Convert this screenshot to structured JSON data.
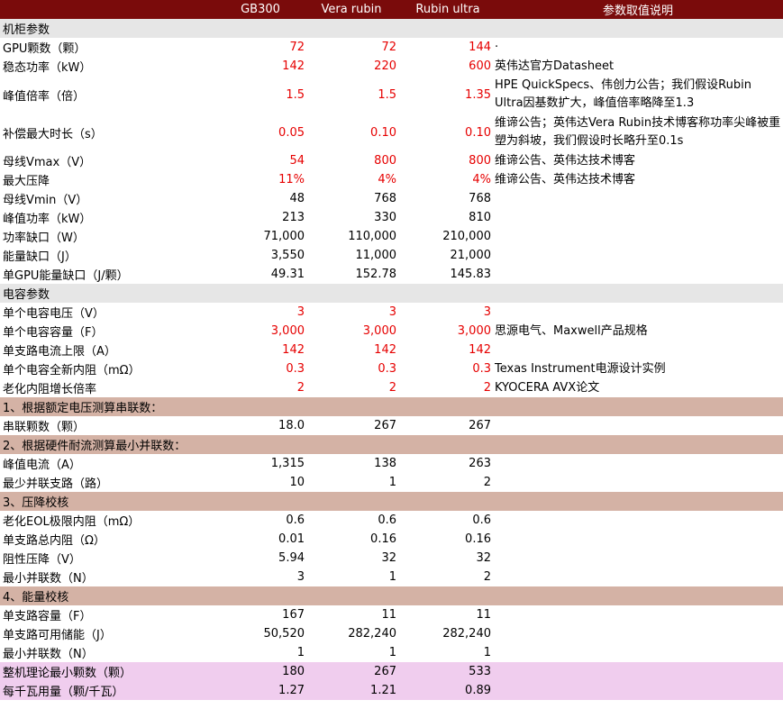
{
  "header": {
    "col_gb300": "GB300",
    "col_vera": "Vera rubin",
    "col_rubin_ultra": "Rubin ultra",
    "col_notes": "参数取值说明"
  },
  "rows": [
    {
      "type": "section-gray",
      "label": "机柜参数"
    },
    {
      "type": "data",
      "label": "GPU颗数（颗）",
      "v": [
        "72",
        "72",
        "144"
      ],
      "red": true,
      "note": "·"
    },
    {
      "type": "data",
      "label": "稳态功率（kW）",
      "v": [
        "142",
        "220",
        "600"
      ],
      "red": true,
      "note": "英伟达官方Datasheet"
    },
    {
      "type": "data",
      "label": "峰值倍率（倍）",
      "v": [
        "1.5",
        "1.5",
        "1.35"
      ],
      "red": true,
      "note": "HPE QuickSpecs、伟创力公告；我们假设Rubin Ultra因基数扩大，峰值倍率略降至1.3",
      "tall": true
    },
    {
      "type": "data",
      "label": "补偿最大时长（s）",
      "v": [
        "0.05",
        "0.10",
        "0.10"
      ],
      "red": true,
      "note": "维谛公告；英伟达Vera Rubin技术博客称功率尖峰被重塑为斜坡，我们假设时长略升至0.1s",
      "tall": true
    },
    {
      "type": "data",
      "label": "母线Vmax（V）",
      "v": [
        "54",
        "800",
        "800"
      ],
      "red": true,
      "note": "维谛公告、英伟达技术博客"
    },
    {
      "type": "data",
      "label": "最大压降",
      "v": [
        "11%",
        "4%",
        "4%"
      ],
      "red": true,
      "note": "维谛公告、英伟达技术博客"
    },
    {
      "type": "data",
      "label": "母线Vmin（V）",
      "v": [
        "48",
        "768",
        "768"
      ],
      "red": false,
      "note": ""
    },
    {
      "type": "data",
      "label": "峰值功率（kW）",
      "v": [
        "213",
        "330",
        "810"
      ],
      "red": false,
      "note": ""
    },
    {
      "type": "data",
      "label": "功率缺口（W）",
      "v": [
        "71,000",
        "110,000",
        "210,000"
      ],
      "red": false,
      "note": ""
    },
    {
      "type": "data",
      "label": "能量缺口（J）",
      "v": [
        "3,550",
        "11,000",
        "21,000"
      ],
      "red": false,
      "note": ""
    },
    {
      "type": "data",
      "label": "单GPU能量缺口（J/颗）",
      "v": [
        "49.31",
        "152.78",
        "145.83"
      ],
      "red": false,
      "note": ""
    },
    {
      "type": "section-gray",
      "label": "电容参数"
    },
    {
      "type": "data",
      "label": "单个电容电压（V）",
      "v": [
        "3",
        "3",
        "3"
      ],
      "red": true,
      "note": ""
    },
    {
      "type": "data",
      "label": "单个电容容量（F）",
      "v": [
        "3,000",
        "3,000",
        "3,000"
      ],
      "red": true,
      "note": "思源电气、Maxwell产品规格"
    },
    {
      "type": "data",
      "label": "单支路电流上限（A）",
      "v": [
        "142",
        "142",
        "142"
      ],
      "red": true,
      "note": ""
    },
    {
      "type": "data",
      "label": "单个电容全新内阻（mΩ）",
      "v": [
        "0.3",
        "0.3",
        "0.3"
      ],
      "red": true,
      "note": "Texas Instrument电源设计实例"
    },
    {
      "type": "data",
      "label": "老化内阻增长倍率",
      "v": [
        "2",
        "2",
        "2"
      ],
      "red": true,
      "note": "KYOCERA AVX论文"
    },
    {
      "type": "section-tan",
      "label": "1、根据额定电压测算串联数："
    },
    {
      "type": "data",
      "label": "串联颗数（颗）",
      "v": [
        "18.0",
        "267",
        "267"
      ],
      "red": false,
      "note": ""
    },
    {
      "type": "section-tan",
      "label": "2、根据硬件耐流测算最小并联数："
    },
    {
      "type": "data",
      "label": "峰值电流（A）",
      "v": [
        "1,315",
        "138",
        "263"
      ],
      "red": false,
      "note": ""
    },
    {
      "type": "data",
      "label": "最少并联支路（路）",
      "v": [
        "10",
        "1",
        "2"
      ],
      "red": false,
      "note": ""
    },
    {
      "type": "section-tan",
      "label": "3、压降校核"
    },
    {
      "type": "data",
      "label": "老化EOL极限内阻（mΩ）",
      "v": [
        "0.6",
        "0.6",
        "0.6"
      ],
      "red": false,
      "note": ""
    },
    {
      "type": "data",
      "label": "单支路总内阻（Ω）",
      "v": [
        "0.01",
        "0.16",
        "0.16"
      ],
      "red": false,
      "note": ""
    },
    {
      "type": "data",
      "label": "阻性压降（V）",
      "v": [
        "5.94",
        "32",
        "32"
      ],
      "red": false,
      "note": ""
    },
    {
      "type": "data",
      "label": "最小并联数（N）",
      "v": [
        "3",
        "1",
        "2"
      ],
      "red": false,
      "note": ""
    },
    {
      "type": "section-tan",
      "label": "4、能量校核"
    },
    {
      "type": "data",
      "label": "单支路容量（F）",
      "v": [
        "167",
        "11",
        "11"
      ],
      "red": false,
      "note": ""
    },
    {
      "type": "data",
      "label": "单支路可用储能（J）",
      "v": [
        "50,520",
        "282,240",
        "282,240"
      ],
      "red": false,
      "note": ""
    },
    {
      "type": "data",
      "label": "最小并联数（N）",
      "v": [
        "1",
        "1",
        "1"
      ],
      "red": false,
      "note": ""
    },
    {
      "type": "summary",
      "label": "整机理论最小颗数（颗）",
      "v": [
        "180",
        "267",
        "533"
      ],
      "red": false,
      "note": ""
    },
    {
      "type": "summary",
      "label": "每千瓦用量（颗/千瓦）",
      "v": [
        "1.27",
        "1.21",
        "0.89"
      ],
      "red": false,
      "note": ""
    }
  ],
  "colors": {
    "header_bg": "#7a0b0b",
    "section_gray": "#e6e6e6",
    "section_tan": "#d4b2a5",
    "summary_pink": "#f0cdee",
    "input_red": "#e60000"
  }
}
